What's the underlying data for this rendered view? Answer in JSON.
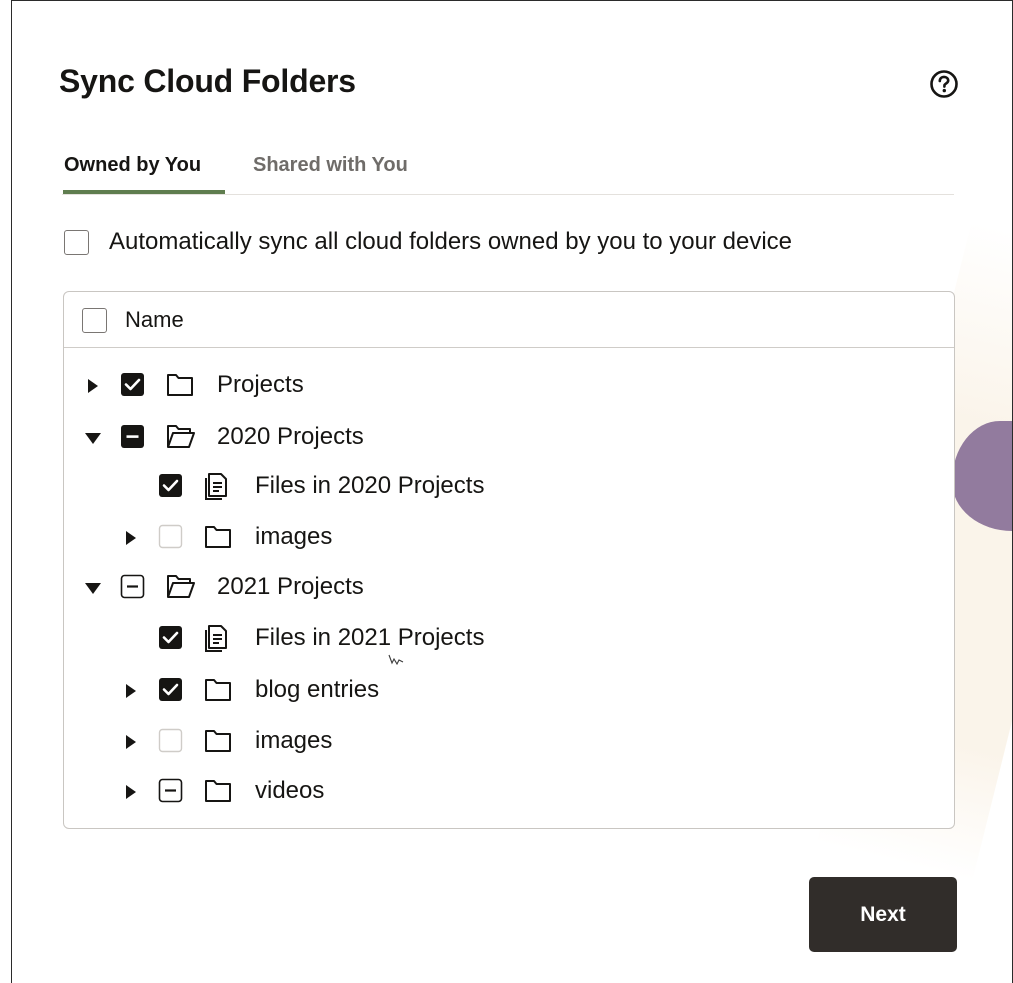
{
  "dialog": {
    "title": "Sync Cloud Folders",
    "help_icon": "help-circle-icon"
  },
  "tabs": [
    {
      "label": "Owned by You",
      "selected": true
    },
    {
      "label": "Shared with You",
      "selected": false
    }
  ],
  "auto_sync": {
    "label": "Automatically sync all cloud folders owned by you to your device",
    "checked": false
  },
  "tree": {
    "header_label": "Name",
    "header_checked": false,
    "rows": [
      {
        "label": "Projects",
        "level": 0,
        "expander": "collapsed",
        "check": "checked",
        "icon": "folder-icon"
      },
      {
        "label": "2020 Projects",
        "level": 0,
        "expander": "expanded",
        "check": "partial-filled",
        "icon": "folder-open-icon"
      },
      {
        "label": "Files in 2020 Projects",
        "level": 1,
        "expander": "none",
        "check": "checked",
        "icon": "files-icon"
      },
      {
        "label": "images",
        "level": 1,
        "expander": "collapsed",
        "check": "unchecked-disabled",
        "icon": "folder-icon"
      },
      {
        "label": "2021 Projects",
        "level": 0,
        "expander": "expanded",
        "check": "partial-outline",
        "icon": "folder-open-icon"
      },
      {
        "label": "Files in 2021 Projects",
        "level": 1,
        "expander": "none",
        "check": "checked",
        "icon": "files-icon"
      },
      {
        "label": "blog entries",
        "level": 1,
        "expander": "collapsed",
        "check": "checked",
        "icon": "folder-icon"
      },
      {
        "label": "images",
        "level": 1,
        "expander": "collapsed",
        "check": "unchecked-disabled",
        "icon": "folder-icon"
      },
      {
        "label": "videos",
        "level": 1,
        "expander": "collapsed",
        "check": "partial-outline",
        "icon": "folder-icon"
      }
    ]
  },
  "footer": {
    "next_label": "Next"
  },
  "colors": {
    "tab_underline": "#5f7d4f",
    "primary_button": "#312d2a",
    "checkbox_fill": "#161513",
    "accent_decoration": "#927b9e"
  }
}
